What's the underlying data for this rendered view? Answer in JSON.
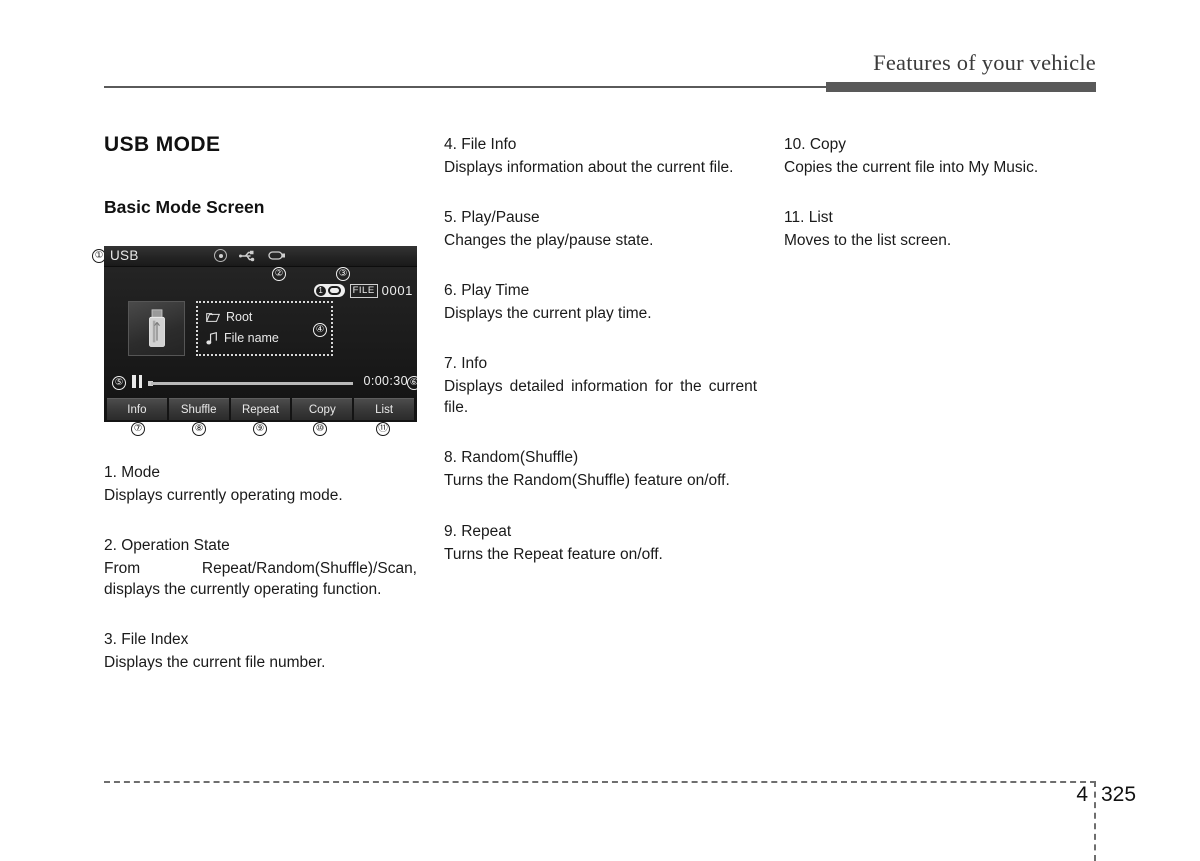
{
  "header": {
    "title": "Features of your vehicle"
  },
  "section": {
    "title": "USB MODE",
    "subtitle": "Basic Mode Screen"
  },
  "figure": {
    "screen": {
      "mode_label": "USB",
      "topbar_icons": [
        "disc-icon",
        "usb-icon",
        "device-icon"
      ],
      "operation_state": {
        "repeat_number": "1",
        "icon": "repeat-loop-icon"
      },
      "file_index": {
        "tag": "FILE",
        "number": "0001"
      },
      "thumbnail_icon": "usb-drive-icon",
      "file_info": {
        "folder_label": "Root",
        "folder_icon": "folder-icon",
        "file_label": "File name",
        "file_icon": "music-note-icon"
      },
      "transport": {
        "playpause_icon": "pause-icon",
        "play_time": "0:00:30"
      },
      "softkeys": [
        {
          "label": "Info"
        },
        {
          "label": "Shuffle"
        },
        {
          "label": "Repeat"
        },
        {
          "label": "Copy"
        },
        {
          "label": "List"
        }
      ]
    },
    "callouts": {
      "n1": "①",
      "n2": "②",
      "n3": "③",
      "n4": "④",
      "n5": "⑤",
      "n6": "⑥",
      "n7": "⑦",
      "n8": "⑧",
      "n9": "⑨",
      "n10": "⑩",
      "n11": "⑪"
    }
  },
  "entries": {
    "left": [
      {
        "title": "1. Mode",
        "body": "Displays currently operating mode."
      },
      {
        "title": "2. Operation State",
        "body": "From Repeat/Random(Shuffle)/Scan, displays the currently operating function."
      },
      {
        "title": "3. File Index",
        "body": "Displays the current file number."
      }
    ],
    "middle": [
      {
        "title": "4. File Info",
        "body": "Displays information about the current file."
      },
      {
        "title": "5. Play/Pause",
        "body": "Changes the play/pause state."
      },
      {
        "title": "6. Play Time",
        "body": "Displays the current play time."
      },
      {
        "title": "7. Info",
        "body": "Displays detailed information for the current file."
      },
      {
        "title": "8. Random(Shuffle)",
        "body": "Turns the Random(Shuffle) feature on/off."
      },
      {
        "title": "9. Repeat",
        "body": "Turns the Repeat feature on/off."
      }
    ],
    "right": [
      {
        "title": "10. Copy",
        "body": "Copies the current file into My Music."
      },
      {
        "title": "11. List",
        "body": "Moves to the list screen."
      }
    ]
  },
  "footer": {
    "chapter": "4",
    "page": "325"
  },
  "colors": {
    "header_bar": "#595959",
    "screen_bg": "#1d1d1d",
    "text": "#1a1a1a"
  }
}
